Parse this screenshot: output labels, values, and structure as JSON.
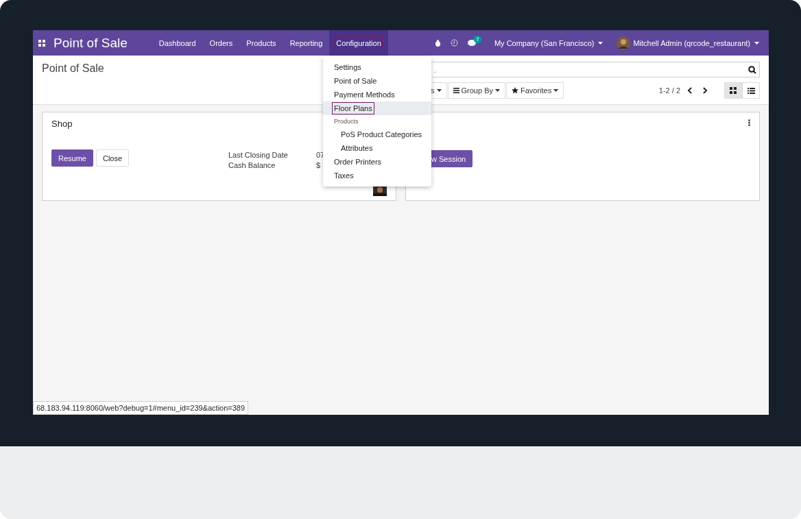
{
  "navbar": {
    "app_title": "Point of Sale",
    "menu": [
      {
        "label": "Dashboard",
        "selected": false
      },
      {
        "label": "Orders",
        "selected": false
      },
      {
        "label": "Products",
        "selected": false
      },
      {
        "label": "Reporting",
        "selected": false
      },
      {
        "label": "Configuration",
        "selected": true
      }
    ],
    "message_count": "7",
    "company": "My Company (San Francisco)",
    "user": "Mitchell Admin (qrcode_restaurant)"
  },
  "breadcrumb": "Point of Sale",
  "search": {
    "placeholder": "."
  },
  "filters": [
    {
      "label": "s",
      "kind": "partial"
    },
    {
      "label": "Group By",
      "kind": "group"
    },
    {
      "label": "Favorites",
      "kind": "favorites"
    }
  ],
  "pager": "1-2 / 2",
  "views": [
    {
      "kind": "kanban",
      "selected": true
    },
    {
      "kind": "list",
      "selected": false
    }
  ],
  "cards": [
    {
      "title": "Shop",
      "buttons": [
        {
          "label": "Resume",
          "kind": "primary"
        },
        {
          "label": "Close",
          "kind": "secondary"
        }
      ],
      "info": [
        {
          "label": "Last Closing Date",
          "value": "07"
        },
        {
          "label": "Cash Balance",
          "value": "$"
        }
      ]
    },
    {
      "buttons": [
        {
          "label": "w Session",
          "kind": "primary"
        }
      ]
    }
  ],
  "dropdown": [
    {
      "label": "Settings",
      "kind": "item",
      "selected": false
    },
    {
      "label": "Point of Sale",
      "kind": "item",
      "selected": false
    },
    {
      "label": "Payment Methods",
      "kind": "item",
      "selected": false
    },
    {
      "label": "Floor Plans",
      "kind": "item",
      "selected": true
    },
    {
      "label": "Products",
      "kind": "header",
      "selected": false
    },
    {
      "label": "PoS Product Categories",
      "kind": "sub",
      "selected": false
    },
    {
      "label": "Attributes",
      "kind": "sub",
      "selected": false
    },
    {
      "label": "Order Printers",
      "kind": "item",
      "selected": false
    },
    {
      "label": "Taxes",
      "kind": "item",
      "selected": false
    }
  ],
  "status_url": "68.183.94.119:8060/web?debug=1#menu_id=239&action=389"
}
